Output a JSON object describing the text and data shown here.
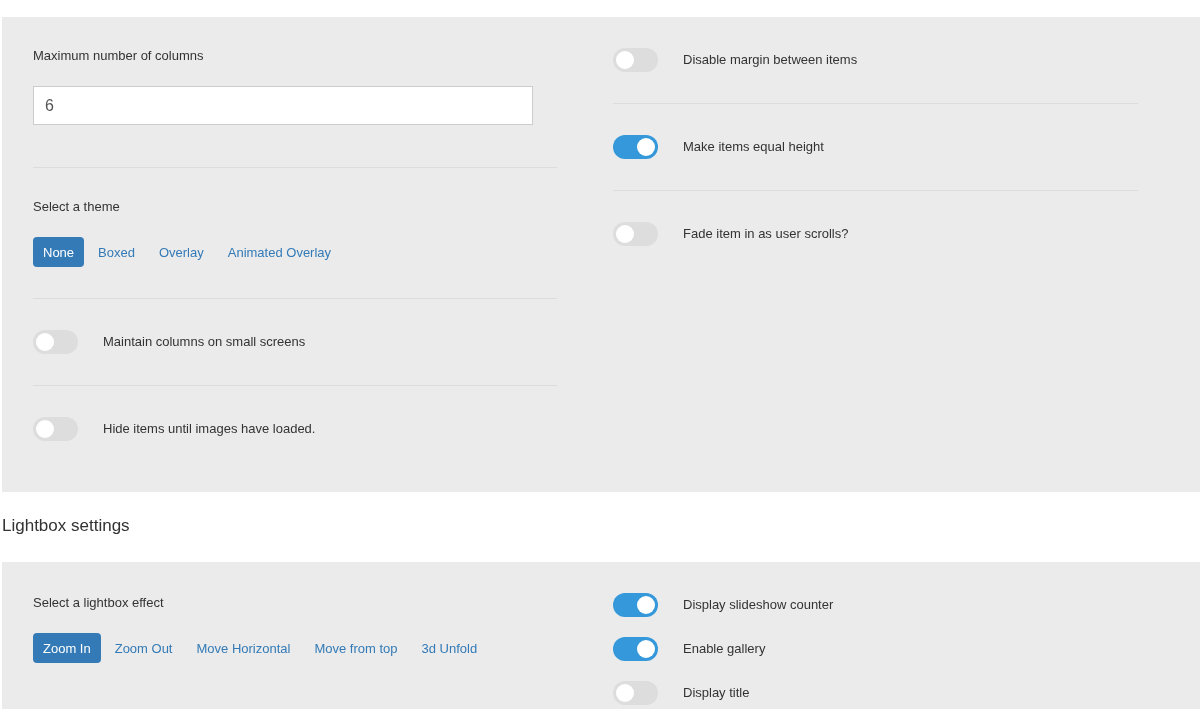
{
  "panels": [
    {
      "dividers": true,
      "left": [
        {
          "kind": "field",
          "label": "Maximum number of columns",
          "value": "6"
        },
        {
          "kind": "buttons",
          "label": "Select a theme",
          "options": [
            {
              "label": "None",
              "selected": true
            },
            {
              "label": "Boxed",
              "selected": false
            },
            {
              "label": "Overlay",
              "selected": false
            },
            {
              "label": "Animated Overlay",
              "selected": false
            }
          ]
        },
        {
          "kind": "toggle",
          "label": "Maintain columns on small screens",
          "on": false
        },
        {
          "kind": "toggle",
          "label": "Hide items until images have loaded.",
          "on": false
        }
      ],
      "right": [
        {
          "kind": "toggle",
          "label": "Disable margin between items",
          "on": false
        },
        {
          "kind": "toggle",
          "label": "Make items equal height",
          "on": true
        },
        {
          "kind": "toggle",
          "label": "Fade item in as user scrolls?",
          "on": false
        }
      ]
    },
    {
      "heading": "Lightbox settings",
      "dividers": false,
      "left": [
        {
          "kind": "buttons",
          "label": "Select a lightbox effect",
          "options": [
            {
              "label": "Zoom In",
              "selected": true
            },
            {
              "label": "Zoom Out",
              "selected": false
            },
            {
              "label": "Move Horizontal",
              "selected": false
            },
            {
              "label": "Move from top",
              "selected": false
            },
            {
              "label": "3d Unfold",
              "selected": false
            }
          ]
        }
      ],
      "right": [
        {
          "kind": "toggle",
          "label": "Display slideshow counter",
          "on": true
        },
        {
          "kind": "toggle",
          "label": "Enable gallery",
          "on": true
        },
        {
          "kind": "toggle",
          "label": "Display title",
          "on": false
        }
      ]
    }
  ]
}
